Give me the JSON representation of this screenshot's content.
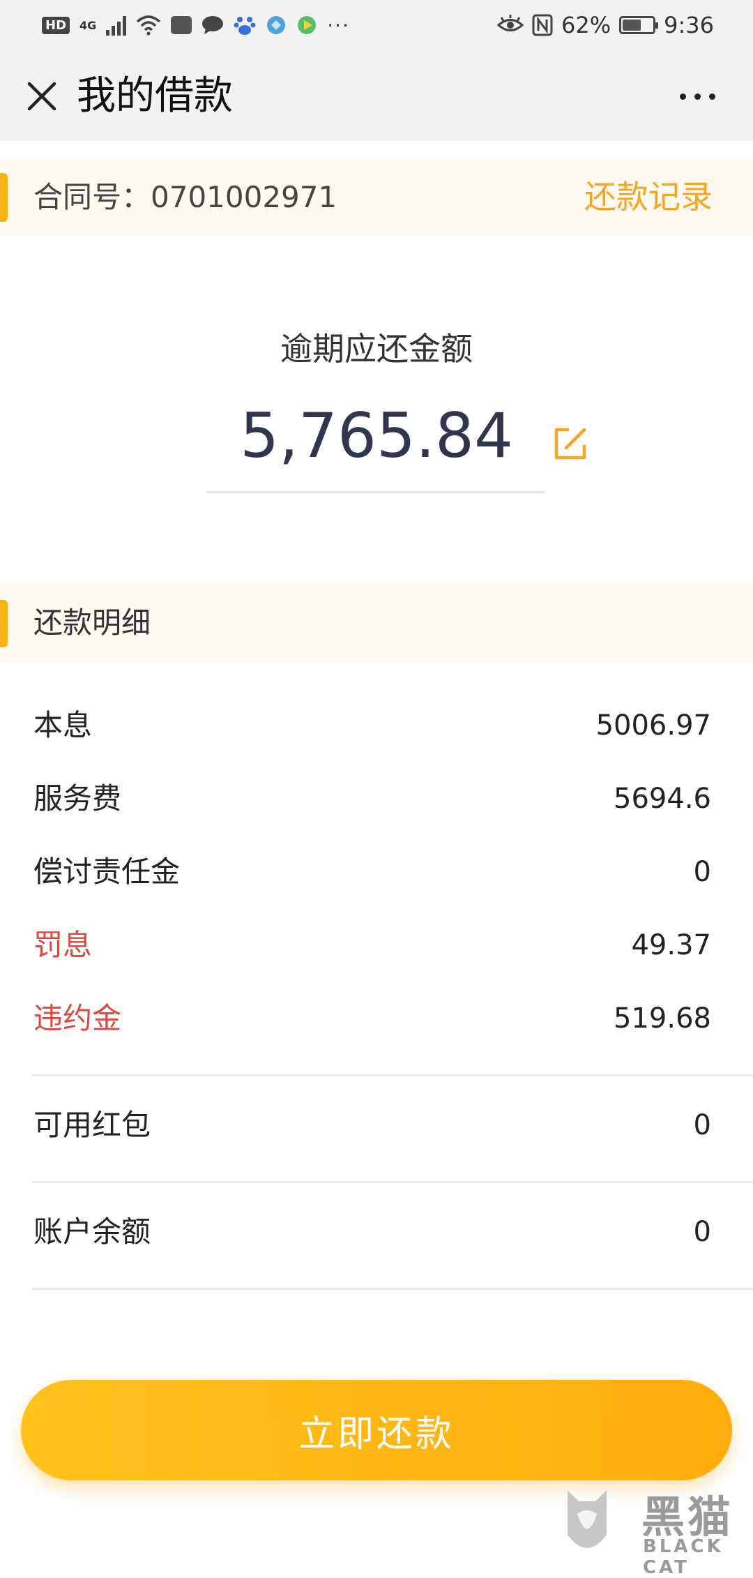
{
  "status_bar": {
    "hd": "HD",
    "network": "4G",
    "battery_percent": "62%",
    "battery_level": 0.62,
    "time": "9:36",
    "overflow": "···"
  },
  "nav": {
    "title": "我的借款"
  },
  "contract": {
    "label": "合同号：0701002971",
    "records_link": "还款记录"
  },
  "amount": {
    "label": "逾期应还金额",
    "value": "5,765.84"
  },
  "details": {
    "title": "还款明细",
    "rows": [
      {
        "label": "本息",
        "value": "5006.97"
      },
      {
        "label": "服务费",
        "value": "5694.6"
      },
      {
        "label": "偿讨责任金",
        "value": "0"
      },
      {
        "label": "罚息",
        "value": "49.37"
      },
      {
        "label": "违约金",
        "value": "519.68"
      }
    ],
    "extra_rows": [
      {
        "label": "可用红包",
        "value": "0"
      },
      {
        "label": "账户余额",
        "value": "0"
      }
    ]
  },
  "pay_button": {
    "label": "立即还款"
  },
  "watermark": {
    "name": "黑猫",
    "sub": "BLACK CAT"
  },
  "colors": {
    "accent": "#f7b215",
    "link": "#f5a623",
    "danger": "#dd4a3c",
    "amount": "#2f3750",
    "button": "#ffb612"
  }
}
